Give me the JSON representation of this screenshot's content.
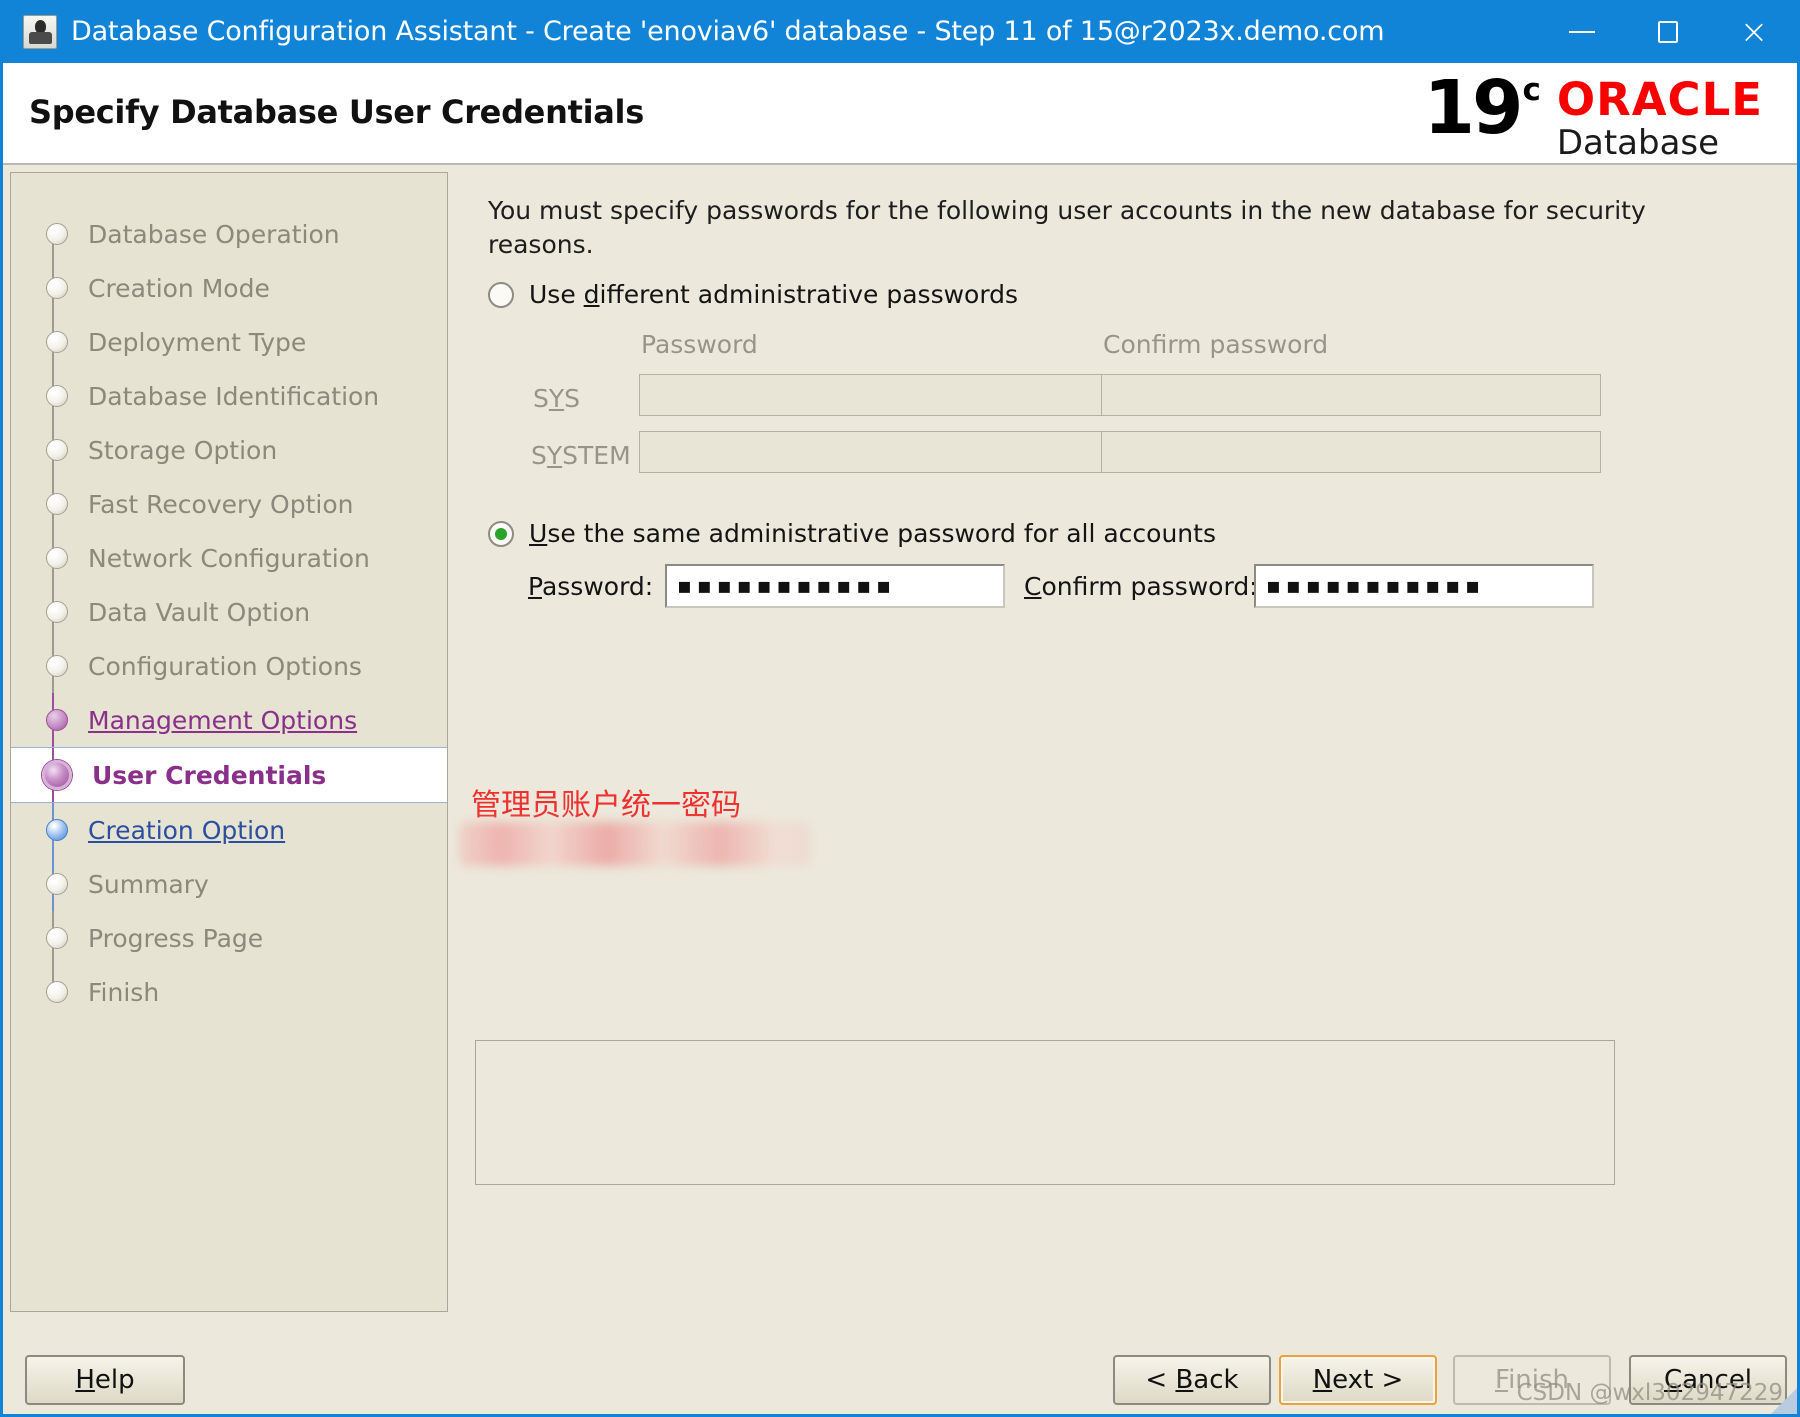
{
  "window": {
    "title": "Database Configuration Assistant - Create 'enoviav6' database - Step 11 of 15@r2023x.demo.com",
    "minimize_label": "",
    "maximize_label": "",
    "close_label": "×"
  },
  "header": {
    "page_title": "Specify Database User Credentials",
    "brand_version": "19",
    "brand_release": "c",
    "brand_name": "ORACLE",
    "brand_product": "Database"
  },
  "sidebar": {
    "items": [
      {
        "label": "Database Operation",
        "state": "pending"
      },
      {
        "label": "Creation Mode",
        "state": "pending"
      },
      {
        "label": "Deployment Type",
        "state": "pending"
      },
      {
        "label": "Database Identification",
        "state": "pending"
      },
      {
        "label": "Storage Option",
        "state": "pending"
      },
      {
        "label": "Fast Recovery Option",
        "state": "pending"
      },
      {
        "label": "Network Configuration",
        "state": "pending"
      },
      {
        "label": "Data Vault Option",
        "state": "pending"
      },
      {
        "label": "Configuration Options",
        "state": "pending"
      },
      {
        "label": "Management Options",
        "state": "visited"
      },
      {
        "label": "User Credentials",
        "state": "current"
      },
      {
        "label": "Creation Option",
        "state": "next"
      },
      {
        "label": "Summary",
        "state": "pending"
      },
      {
        "label": "Progress Page",
        "state": "pending"
      },
      {
        "label": "Finish",
        "state": "pending"
      }
    ]
  },
  "main": {
    "intro_text": "You must specify passwords for the following user accounts in the new database for security reasons.",
    "option_different": {
      "label_pre": "Use ",
      "label_key": "d",
      "label_post": "ifferent administrative passwords",
      "selected": false
    },
    "column_headers": {
      "password": "Password",
      "confirm_password": "Confirm password"
    },
    "accounts": [
      {
        "name_pre": "S",
        "name_key": "Y",
        "name_post": "S",
        "password": "",
        "confirm": ""
      },
      {
        "name_pre": "S",
        "name_key": "Y",
        "name_post": "STEM",
        "password": "",
        "confirm": ""
      }
    ],
    "option_same": {
      "label_pre": "",
      "label_key": "U",
      "label_post": "se the same administrative password for all accounts",
      "selected": true
    },
    "same_password": {
      "password_label_pre": "",
      "password_label_key": "P",
      "password_label_post": "assword:",
      "password_value": "▪▪▪▪▪▪▪▪▪▪▪",
      "confirm_label_pre": "",
      "confirm_label_key": "C",
      "confirm_label_post": "onfirm password:",
      "confirm_value": "▪▪▪▪▪▪▪▪▪▪▪"
    },
    "annotation_text": "管理员账户统一密码"
  },
  "footer": {
    "help": {
      "pre": "",
      "key": "H",
      "post": "elp"
    },
    "back": {
      "pre": "< ",
      "key": "B",
      "post": "ack"
    },
    "next": {
      "pre": "",
      "key": "N",
      "post": "ext >"
    },
    "finish": {
      "pre": "",
      "key": "F",
      "post": "inish"
    },
    "cancel": {
      "pre": "",
      "key": "C",
      "post": "ancel"
    }
  },
  "watermark": "CSDN @wxl302947229"
}
